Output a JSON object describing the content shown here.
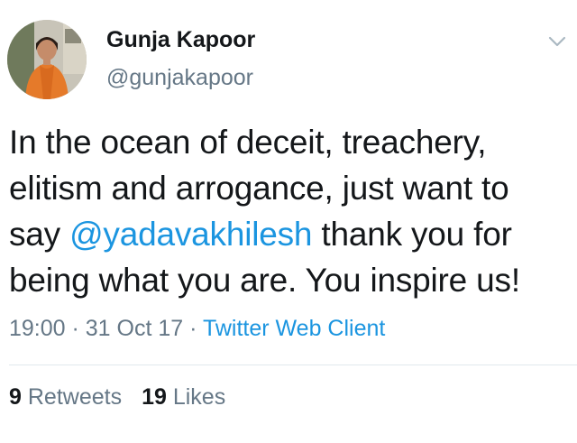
{
  "author": {
    "display_name": "Gunja Kapoor",
    "handle": "@gunjakapoor"
  },
  "tweet": {
    "line1": "In the ocean of deceit, treachery,",
    "line2": "elitism and arrogance, just want to",
    "line3_prefix": "say ",
    "mention": "@yadavakhilesh",
    "line3_suffix": " thank you for",
    "line4": "being what you are. You inspire us!"
  },
  "meta": {
    "time": "19:00",
    "separator": " · ",
    "date": "31 Oct 17",
    "source": "Twitter Web Client"
  },
  "stats": {
    "retweets_count": "9",
    "retweets_label": "Retweets",
    "likes_count": "19",
    "likes_label": "Likes"
  },
  "colors": {
    "link": "#1b95e0",
    "secondary_text": "#657786",
    "primary_text": "#14171a"
  },
  "icons": {
    "caret": "chevron-down-icon"
  }
}
